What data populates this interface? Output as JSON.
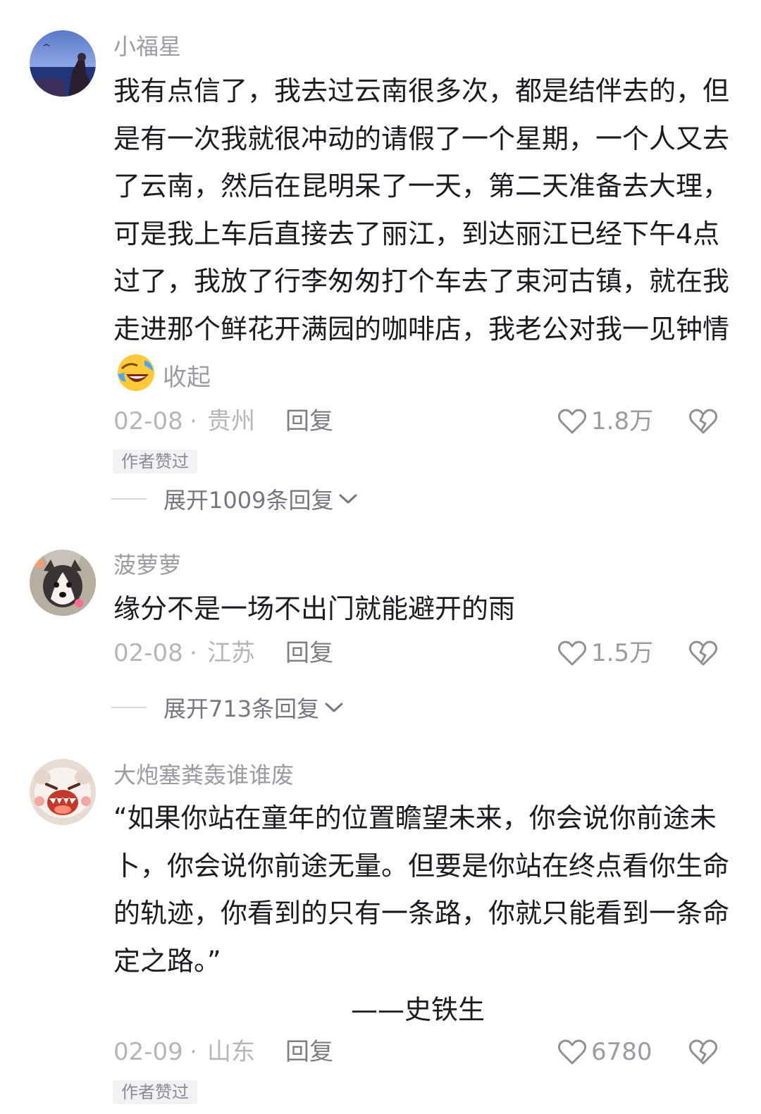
{
  "comments": [
    {
      "username": "小福星",
      "text": "我有点信了，我去过云南很多次，都是结伴去的，但是有一次我就很冲动的请假了一个星期，一个人又去了云南，然后在昆明呆了一天，第二天准备去大理，可是我上车后直接去了丽江，到达丽江已经下午4点过了，我放了行李匆匆打个车去了束河古镇，就在我走进那个鲜花开满园的咖啡店，我老公对我一见钟情",
      "emoji": "laughing-tears",
      "collapse_label": "收起",
      "date": "02-08",
      "dot": "·",
      "location": "贵州",
      "reply_label": "回复",
      "likes": "1.8万",
      "badge": "作者赞过",
      "expand_label": "展开1009条回复"
    },
    {
      "username": "菠萝萝",
      "text": "缘分不是一场不出门就能避开的雨",
      "date": "02-08",
      "dot": "·",
      "location": "江苏",
      "reply_label": "回复",
      "likes": "1.5万",
      "expand_label": "展开713条回复"
    },
    {
      "username": "大炮塞粪轰谁谁废",
      "text": "“如果你站在童年的位置瞻望未来，你会说你前途未卜，你会说你前途无量。但要是你站在终点看你生命的轨迹，你看到的只有一条路，你就只能看到一条命定之路。”",
      "signature": "——史铁生",
      "date": "02-09",
      "dot": "·",
      "location": "山东",
      "reply_label": "回复",
      "likes": "6780",
      "badge": "作者赞过"
    }
  ],
  "icons": {
    "like": "heart-outline-icon",
    "dislike": "broken-heart-icon",
    "expand": "chevron-down-icon"
  },
  "colors": {
    "text_primary": "#1b1c22",
    "text_secondary": "#9a9ca3",
    "meta": "#b4b6bc",
    "badge_bg": "#f2f2f4"
  }
}
